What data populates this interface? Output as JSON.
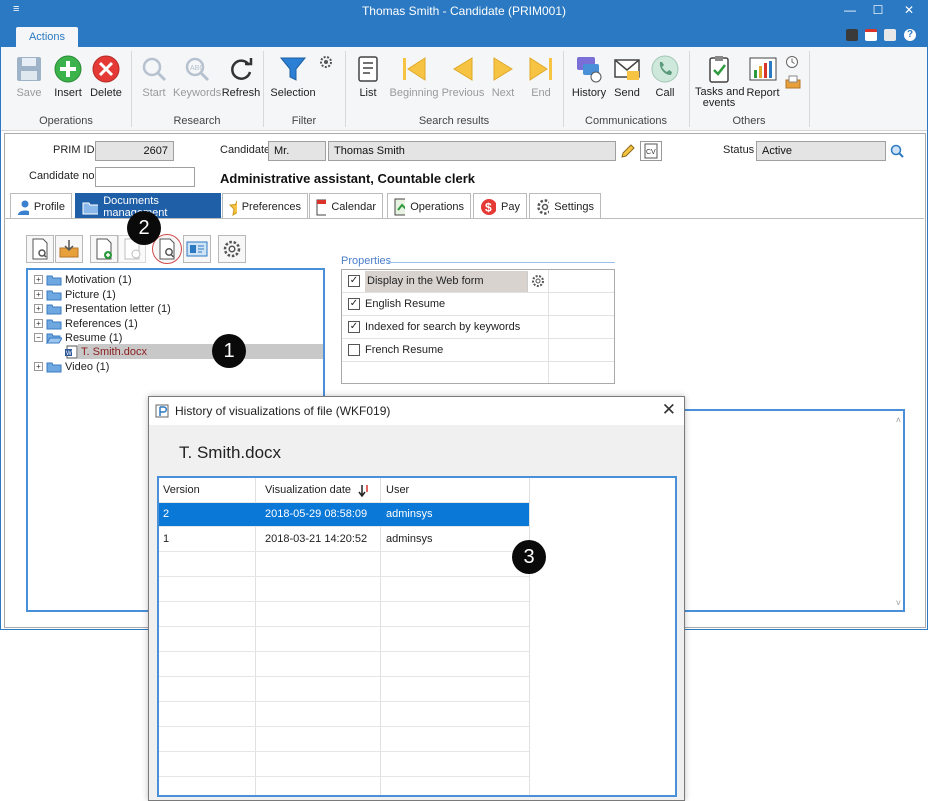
{
  "window": {
    "title": "Thomas Smith - Candidate (PRIM001)",
    "sysmenu": "≡",
    "minimize": "—",
    "maximize": "☐",
    "close": "✕"
  },
  "ribbon": {
    "tab": "Actions",
    "buttons": {
      "save": "Save",
      "insert": "Insert",
      "delete": "Delete",
      "start": "Start",
      "keywords": "Keywords",
      "refresh": "Refresh",
      "selection": "Selection",
      "list": "List",
      "beginning": "Beginning",
      "previous": "Previous",
      "next": "Next",
      "end": "End",
      "history": "History",
      "send": "Send",
      "call": "Call",
      "tasks_line1": "Tasks and",
      "tasks_line2": "events",
      "report": "Report"
    },
    "groups": {
      "operations": "Operations",
      "research": "Research",
      "filter": "Filter",
      "search_results": "Search results",
      "communications": "Communications",
      "others": "Others"
    }
  },
  "form": {
    "prim_id_label": "PRIM ID",
    "prim_id": "2607",
    "candidate_label": "Candidate",
    "salutation": "Mr.",
    "candidate_name": "Thomas Smith",
    "status_label": "Status",
    "status": "Active",
    "candidate_no_label": "Candidate no.",
    "candidate_no": "",
    "job_title": "Administrative assistant, Countable clerk"
  },
  "record_tabs": [
    "Profile",
    "Documents management",
    "Preferences",
    "Calendar",
    "Operations",
    "Pay",
    "Settings"
  ],
  "tree": {
    "items": [
      "Motivation (1)",
      "Picture (1)",
      "Presentation letter (1)",
      "References (1)",
      "Resume (1)",
      "T. Smith.docx",
      "Video (1)"
    ]
  },
  "properties": {
    "legend": "Properties",
    "rows": [
      {
        "label": "Display in the Web form",
        "checked": true
      },
      {
        "label": "English Resume",
        "checked": true
      },
      {
        "label": "Indexed for search by keywords",
        "checked": true
      },
      {
        "label": "French Resume",
        "checked": false
      }
    ]
  },
  "callouts": [
    "1",
    "2",
    "3"
  ],
  "dialog": {
    "title": "History of visualizations of file (WKF019)",
    "close": "✕",
    "file_name": "T. Smith.docx",
    "columns": [
      "Version",
      "Visualization date",
      "User"
    ],
    "rows": [
      {
        "version": "2",
        "date": "2018-05-29 08:58:09",
        "user": "adminsys"
      },
      {
        "version": "1",
        "date": "2018-03-21 14:20:52",
        "user": "adminsys"
      }
    ]
  },
  "colors": {
    "accent": "#2b79c2",
    "selected_row": "#0a78d7",
    "active_tab": "#1f5fa8"
  }
}
